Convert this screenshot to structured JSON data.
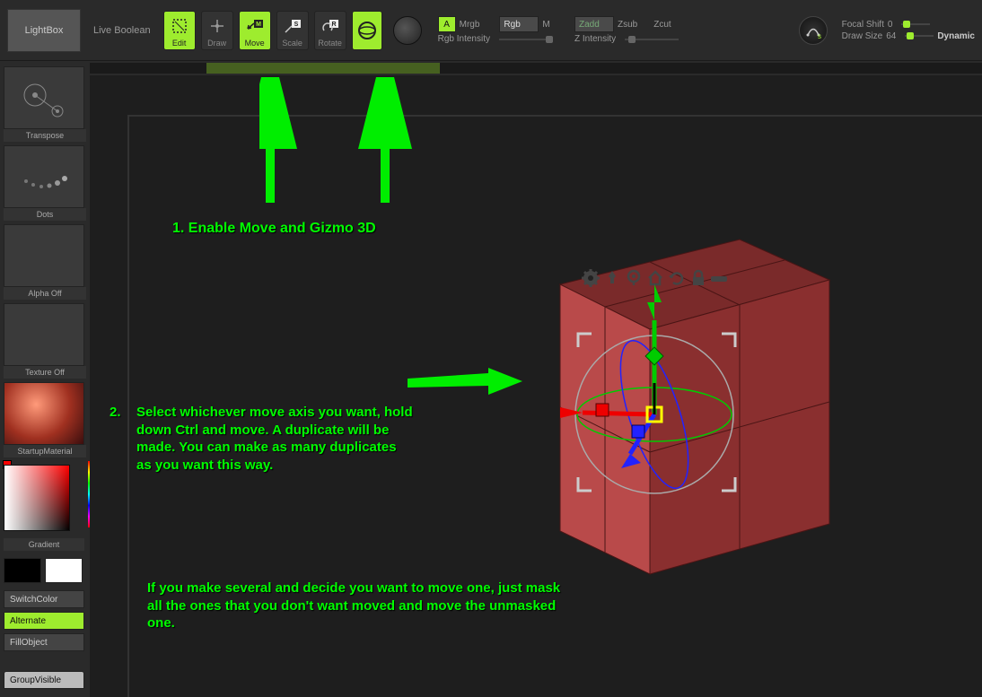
{
  "toolbar": {
    "lightbox": "LightBox",
    "live_boolean": "Live Boolean",
    "tools": {
      "edit": "Edit",
      "draw": "Draw",
      "move": "Move",
      "scale": "Scale",
      "rotate": "Rotate",
      "gizmo": ""
    },
    "color_mode": {
      "a": "A",
      "mrgb": "Mrgb",
      "rgb": "Rgb",
      "m": "M",
      "rgb_intensity": "Rgb Intensity"
    },
    "z_mode": {
      "zadd": "Zadd",
      "zsub": "Zsub",
      "zcut": "Zcut",
      "z_intensity": "Z Intensity"
    },
    "focal_shift_label": "Focal Shift",
    "focal_shift_value": "0",
    "draw_size_label": "Draw Size",
    "draw_size_value": "64",
    "dynamic": "Dynamic"
  },
  "sidebar": {
    "transpose": "Transpose",
    "dots": "Dots",
    "alpha_off": "Alpha Off",
    "texture_off": "Texture Off",
    "startup_material": "StartupMaterial",
    "gradient": "Gradient",
    "switch_color": "SwitchColor",
    "alternate": "Alternate",
    "fill_object": "FillObject",
    "group_visible": "GroupVisible"
  },
  "gizmo_icons": {
    "gear": "gear-icon",
    "pin": "pin-icon",
    "location": "location-icon",
    "home": "home-icon",
    "reset": "reset-icon",
    "lock": "lock-icon",
    "sticky": "sticky-icon"
  },
  "annotations": {
    "step1": "1.   Enable Move and Gizmo 3D",
    "step2num": "2.",
    "step2": "Select whichever move axis you want, hold down Ctrl and move. A duplicate will be made. You can make as many duplicates as you want this way.",
    "note": "If you make several and decide you want to move one, just mask all the ones that you don't want moved and move the unmasked one."
  },
  "colors": {
    "accent": "#9eec2e",
    "arrow": "#00e000",
    "cube_light": "#b94a4a",
    "cube_dark": "#8a2f2f",
    "cube_top": "#7a2a2a"
  }
}
